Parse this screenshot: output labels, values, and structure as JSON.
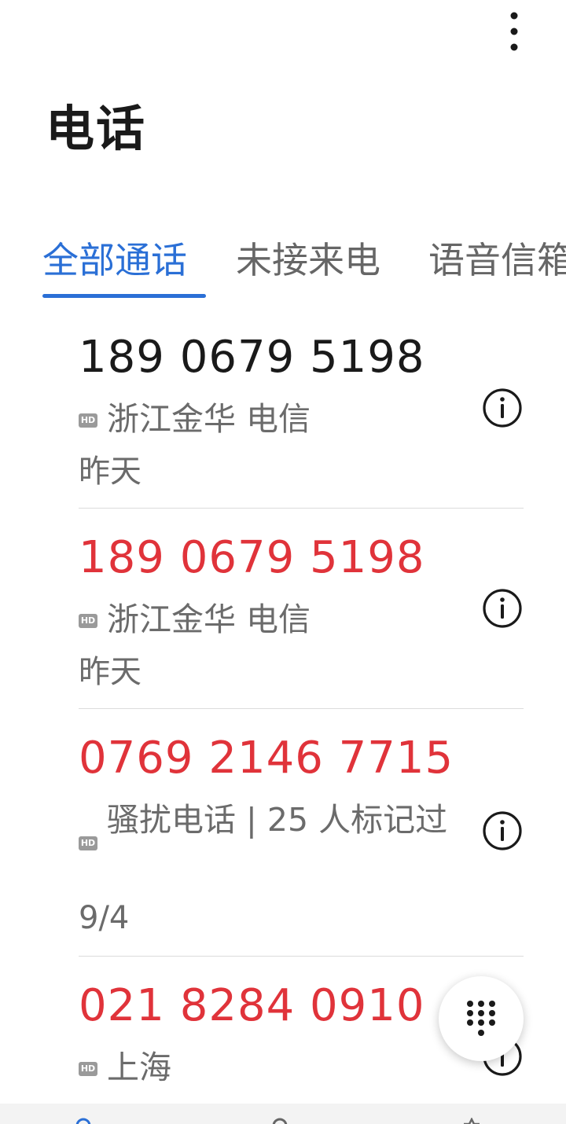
{
  "header": {
    "title": "电话",
    "more_icon": "more-vertical-icon"
  },
  "tabs": [
    {
      "label": "全部通话",
      "active": true
    },
    {
      "label": "未接来电",
      "active": false
    },
    {
      "label": "语音信箱",
      "active": false
    }
  ],
  "calls": [
    {
      "number": "189 0679 5198",
      "type": "normal",
      "hd": "HD",
      "location": "浙江金华 电信",
      "date": "昨天"
    },
    {
      "number": "189 0679 5198",
      "type": "missed",
      "hd": "HD",
      "location": "浙江金华 电信",
      "date": "昨天"
    },
    {
      "number": "0769 2146 7715",
      "type": "missed",
      "hd": "HD",
      "location": "骚扰电话 | 25 人标记过",
      "date": "9/4"
    },
    {
      "number": "021 8284 0910",
      "type": "missed",
      "hd": "HD",
      "location": "上海",
      "date": ""
    }
  ],
  "fab": {
    "icon": "dialpad-icon"
  },
  "colors": {
    "accent": "#2a6fd6",
    "missed": "#e0333a",
    "text_primary": "#1a1a1a",
    "text_secondary": "#6b6b6b"
  }
}
